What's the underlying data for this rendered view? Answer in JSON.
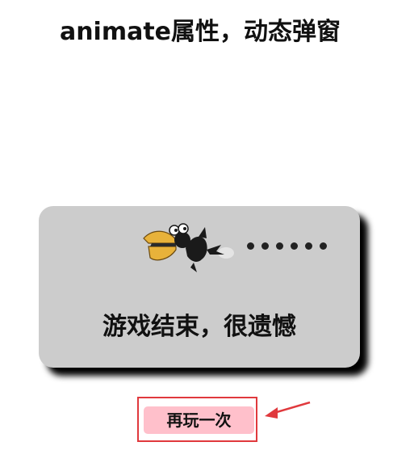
{
  "page": {
    "title": "animate属性，动态弹窗"
  },
  "popup": {
    "message": "游戏结束，很遗憾",
    "image": "flappy-bird-crashing-icon",
    "trail_dots": 6
  },
  "actions": {
    "replay_label": "再玩一次"
  },
  "annotation": {
    "icon": "red-pointer-arrow-icon"
  },
  "colors": {
    "popup_background": "#cccccc",
    "popup_shadow": "#000000",
    "button_background": "#ffc0cb",
    "highlight_red": "#e0393d",
    "bird_beak": "#e8b23a",
    "bird_body": "#1a1a1a"
  }
}
